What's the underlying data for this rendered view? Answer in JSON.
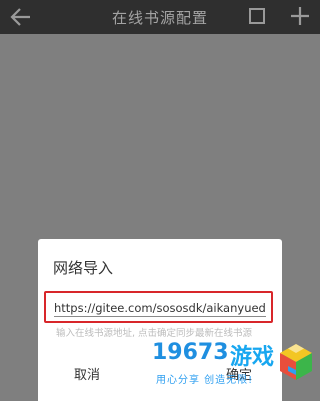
{
  "header": {
    "title": "在线书源配置"
  },
  "dialog": {
    "title": "网络导入",
    "url_value": "https://gitee.com/sososdk/aikanyuedu/",
    "hint": "输入在线书源地址, 点击确定同步最新在线书源",
    "cancel_label": "取消",
    "confirm_label": "确定"
  },
  "watermark": {
    "number": "19673",
    "word": "游戏",
    "slogan": "用心分享 创造无限!"
  },
  "colors": {
    "topbar": "#2f2f2f",
    "overlay": "#7f7f7f",
    "highlight": "#d8262a",
    "watermark": "#1f8fe0"
  }
}
